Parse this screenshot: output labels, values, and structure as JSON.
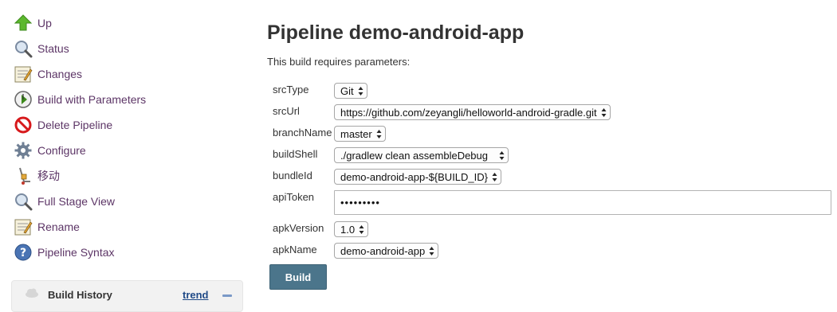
{
  "sidebar": {
    "tasks": [
      {
        "label": "Up",
        "icon": "up-arrow-icon"
      },
      {
        "label": "Status",
        "icon": "magnifier-icon"
      },
      {
        "label": "Changes",
        "icon": "notepad-icon"
      },
      {
        "label": "Build with Parameters",
        "icon": "clock-icon"
      },
      {
        "label": "Delete Pipeline",
        "icon": "no-entry-icon"
      },
      {
        "label": "Configure",
        "icon": "gear-icon"
      },
      {
        "label": "移动",
        "icon": "hand-truck-icon"
      },
      {
        "label": "Full Stage View",
        "icon": "magnifier-icon"
      },
      {
        "label": "Rename",
        "icon": "notepad-icon"
      },
      {
        "label": "Pipeline Syntax",
        "icon": "help-icon"
      }
    ],
    "build_history": {
      "title": "Build History",
      "trend_label": "trend"
    }
  },
  "main": {
    "title": "Pipeline demo-android-app",
    "intro": "This build requires parameters:",
    "params": [
      {
        "name": "srcType",
        "value": "Git"
      },
      {
        "name": "srcUrl",
        "value": "https://github.com/zeyangli/helloworld-android-gradle.git"
      },
      {
        "name": "branchName",
        "value": "master"
      },
      {
        "name": "buildShell",
        "value": "./gradlew clean assembleDebug"
      },
      {
        "name": "bundleId",
        "value": "demo-android-app-${BUILD_ID}"
      },
      {
        "name": "apiToken",
        "value": "•••••••••"
      },
      {
        "name": "apkVersion",
        "value": "1.0"
      },
      {
        "name": "apkName",
        "value": "demo-android-app"
      }
    ],
    "build_button": "Build"
  },
  "colors": {
    "link": "#5c3566",
    "trend_link": "#204a87",
    "build_button_bg": "#4b758b"
  }
}
